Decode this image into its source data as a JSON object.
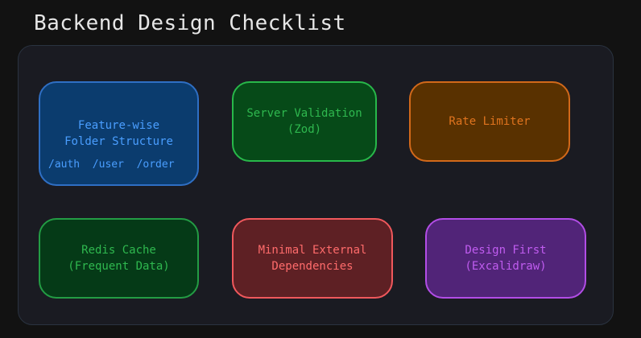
{
  "title": "Backend Design Checklist",
  "colors": {
    "background": "#121212",
    "board": "#1a1b22",
    "blue": "#4a9eff",
    "green": "#2fb84f",
    "orange": "#e0741e",
    "red": "#ff6b6b",
    "purple": "#c05cf0"
  },
  "cards": [
    {
      "id": "feature-folder",
      "label": "Feature-wise\nFolder Structure",
      "sub": "/auth  /user  /order"
    },
    {
      "id": "server-validation",
      "label": "Server Validation\n(Zod)"
    },
    {
      "id": "rate-limiter",
      "label": "Rate Limiter"
    },
    {
      "id": "redis-cache",
      "label": "Redis Cache\n(Frequent Data)"
    },
    {
      "id": "minimal-deps",
      "label": "Minimal External\nDependencies"
    },
    {
      "id": "design-first",
      "label": "Design First\n(Excalidraw)"
    }
  ]
}
